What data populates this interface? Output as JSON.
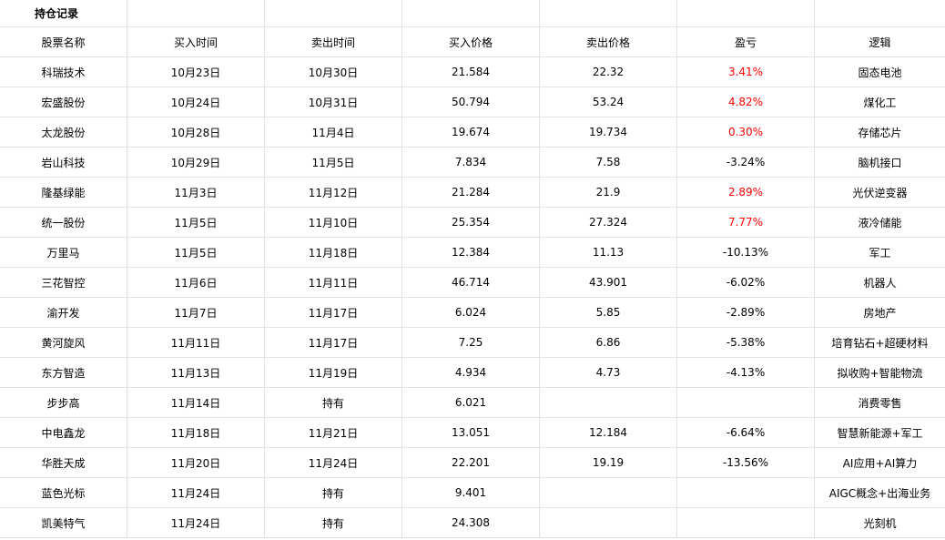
{
  "sheet": {
    "title": "持仓记录",
    "headers": [
      "股票名称",
      "买入时间",
      "卖出时间",
      "买入价格",
      "卖出价格",
      "盈亏",
      "逻辑"
    ],
    "rows": [
      {
        "name": "科瑞技术",
        "buy_date": "10月23日",
        "sell_date": "10月30日",
        "buy_price": "21.584",
        "sell_price": "22.32",
        "pnl": "3.41%",
        "logic": "固态电池",
        "positive": true
      },
      {
        "name": "宏盛股份",
        "buy_date": "10月24日",
        "sell_date": "10月31日",
        "buy_price": "50.794",
        "sell_price": "53.24",
        "pnl": "4.82%",
        "logic": "煤化工",
        "positive": true
      },
      {
        "name": "太龙股份",
        "buy_date": "10月28日",
        "sell_date": "11月4日",
        "buy_price": "19.674",
        "sell_price": "19.734",
        "pnl": "0.30%",
        "logic": "存储芯片",
        "positive": true
      },
      {
        "name": "岩山科技",
        "buy_date": "10月29日",
        "sell_date": "11月5日",
        "buy_price": "7.834",
        "sell_price": "7.58",
        "pnl": "-3.24%",
        "logic": "脑机接口",
        "positive": false
      },
      {
        "name": "隆基绿能",
        "buy_date": "11月3日",
        "sell_date": "11月12日",
        "buy_price": "21.284",
        "sell_price": "21.9",
        "pnl": "2.89%",
        "logic": "光伏逆变器",
        "positive": true
      },
      {
        "name": "统一股份",
        "buy_date": "11月5日",
        "sell_date": "11月10日",
        "buy_price": "25.354",
        "sell_price": "27.324",
        "pnl": "7.77%",
        "logic": "液冷储能",
        "positive": true
      },
      {
        "name": "万里马",
        "buy_date": "11月5日",
        "sell_date": "11月18日",
        "buy_price": "12.384",
        "sell_price": "11.13",
        "pnl": "-10.13%",
        "logic": "军工",
        "positive": false
      },
      {
        "name": "三花智控",
        "buy_date": "11月6日",
        "sell_date": "11月11日",
        "buy_price": "46.714",
        "sell_price": "43.901",
        "pnl": "-6.02%",
        "logic": "机器人",
        "positive": false
      },
      {
        "name": "渝开发",
        "buy_date": "11月7日",
        "sell_date": "11月17日",
        "buy_price": "6.024",
        "sell_price": "5.85",
        "pnl": "-2.89%",
        "logic": "房地产",
        "positive": false
      },
      {
        "name": "黄河旋风",
        "buy_date": "11月11日",
        "sell_date": "11月17日",
        "buy_price": "7.25",
        "sell_price": "6.86",
        "pnl": "-5.38%",
        "logic": "培育钻石+超硬材料",
        "positive": false
      },
      {
        "name": "东方智造",
        "buy_date": "11月13日",
        "sell_date": "11月19日",
        "buy_price": "4.934",
        "sell_price": "4.73",
        "pnl": "-4.13%",
        "logic": "拟收购+智能物流",
        "positive": false
      },
      {
        "name": "步步高",
        "buy_date": "11月14日",
        "sell_date": "持有",
        "buy_price": "6.021",
        "sell_price": "",
        "pnl": "",
        "logic": "消费零售",
        "positive": false
      },
      {
        "name": "中电鑫龙",
        "buy_date": "11月18日",
        "sell_date": "11月21日",
        "buy_price": "13.051",
        "sell_price": "12.184",
        "pnl": "-6.64%",
        "logic": "智慧新能源+军工",
        "positive": false
      },
      {
        "name": "华胜天成",
        "buy_date": "11月20日",
        "sell_date": "11月24日",
        "buy_price": "22.201",
        "sell_price": "19.19",
        "pnl": "-13.56%",
        "logic": "AI应用+AI算力",
        "positive": false
      },
      {
        "name": "蓝色光标",
        "buy_date": "11月24日",
        "sell_date": "持有",
        "buy_price": "9.401",
        "sell_price": "",
        "pnl": "",
        "logic": "AIGC概念+出海业务",
        "positive": false
      },
      {
        "name": "凯美特气",
        "buy_date": "11月24日",
        "sell_date": "持有",
        "buy_price": "24.308",
        "sell_price": "",
        "pnl": "",
        "logic": "光刻机",
        "positive": false
      }
    ]
  },
  "colors": {
    "profit": "#ff0000",
    "grid": "#e3e3e3"
  }
}
